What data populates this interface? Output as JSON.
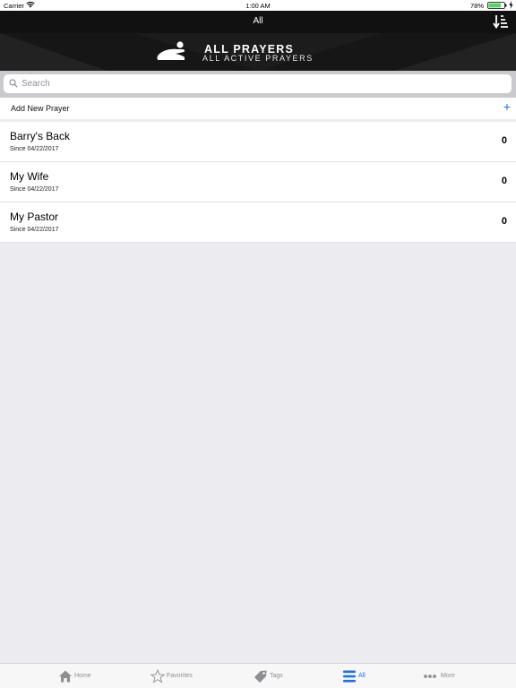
{
  "status_bar": {
    "carrier": "Carrier",
    "time": "1:00 AM",
    "battery": "78%",
    "icons": [
      "wifi-icon",
      "battery-icon",
      "charging-icon"
    ]
  },
  "nav": {
    "title": "All",
    "sort_icon": "sort-icon"
  },
  "banner": {
    "logo_icon": "praying-person-icon",
    "title": "ALL PRAYERS",
    "subtitle": "ALL ACTIVE PRAYERS"
  },
  "search": {
    "placeholder": "Search",
    "value": "",
    "icon": "search-icon"
  },
  "add_prayer": {
    "label": "Add New Prayer",
    "icon": "plus-icon"
  },
  "prayers": [
    {
      "name": "Barry's Back",
      "since": "Since 04/22/2017",
      "count": "0"
    },
    {
      "name": "My Wife",
      "since": "Since 04/22/2017",
      "count": "0"
    },
    {
      "name": "My Pastor",
      "since": "Since 04/22/2017",
      "count": "0"
    }
  ],
  "tabs": [
    {
      "label": "Home",
      "icon": "home-icon",
      "active": false
    },
    {
      "label": "Favorites",
      "icon": "star-icon",
      "active": false
    },
    {
      "label": "Tags",
      "icon": "tag-icon",
      "active": false
    },
    {
      "label": "All",
      "icon": "list-icon",
      "active": true
    },
    {
      "label": "More",
      "icon": "more-icon",
      "active": false
    }
  ],
  "colors": {
    "accent": "#1e6fe6",
    "nav_background": "#111111",
    "page_background": "#ebebf0",
    "search_background": "#c9c9ce",
    "inactive_tab": "#8e8e93",
    "battery_fill": "#4cd964"
  }
}
